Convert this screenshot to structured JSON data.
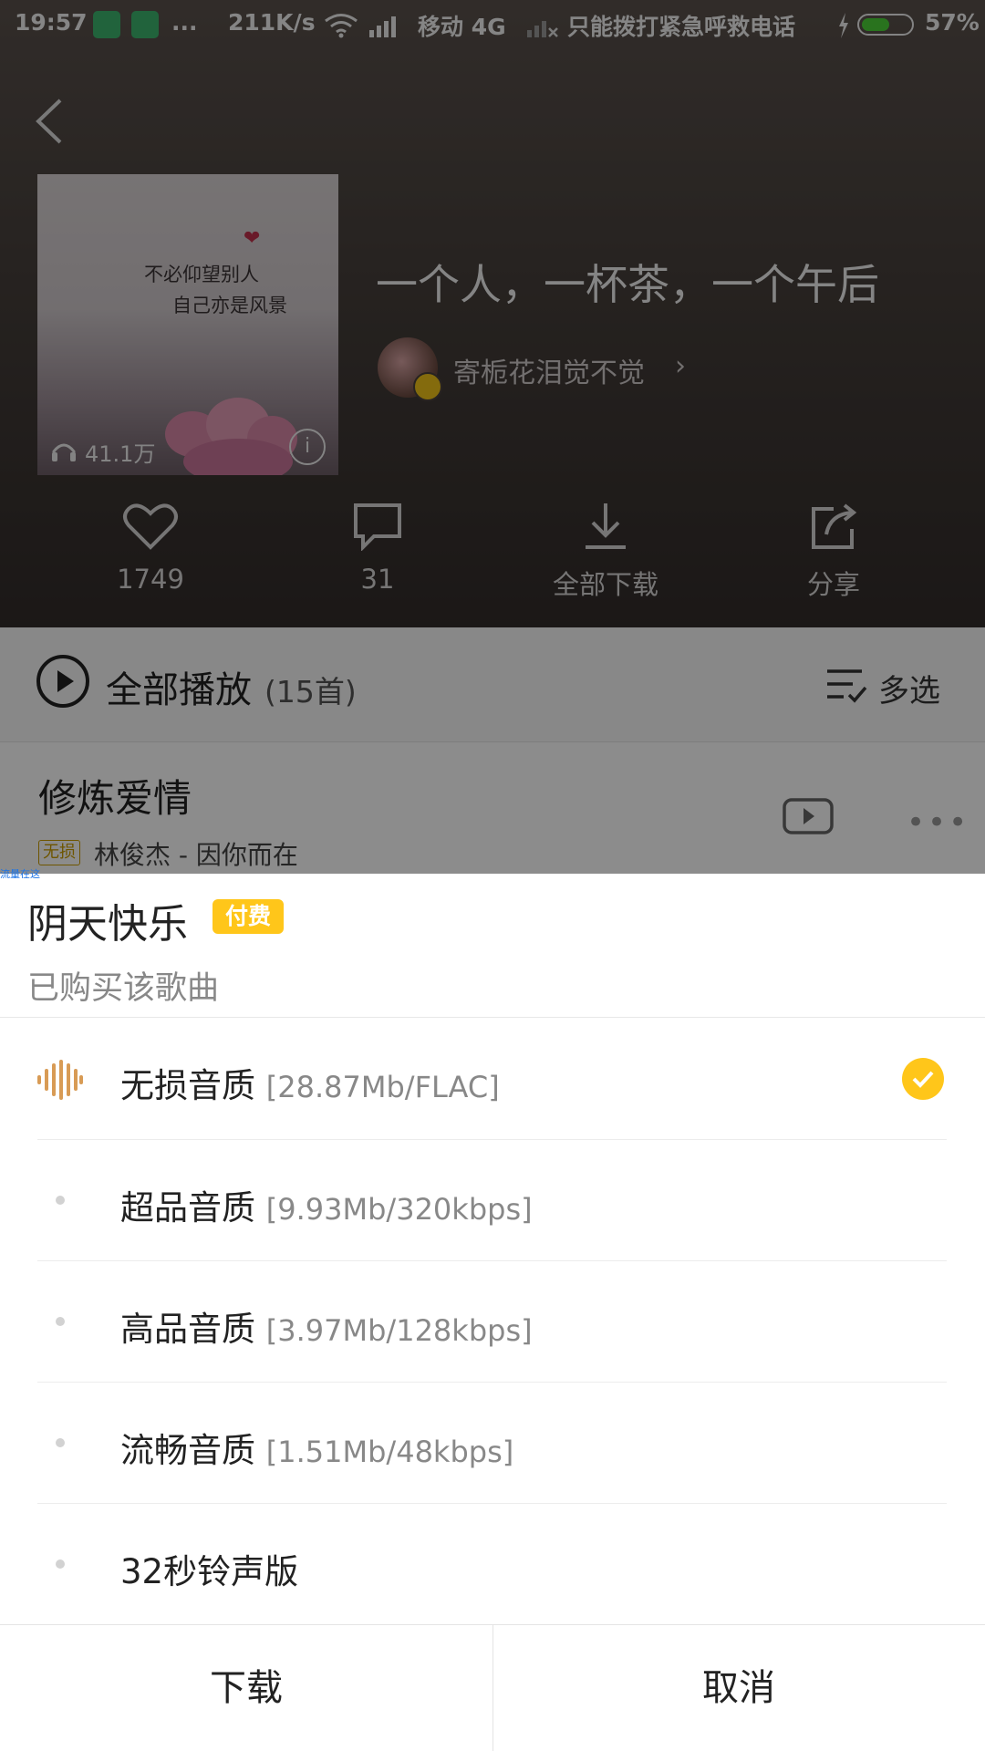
{
  "status_bar": {
    "time": "19:57",
    "overflow": "...",
    "net_speed": "211K/s",
    "carrier": "移动 4G",
    "emergency_text": "只能拨打紧急呼救电话",
    "battery": "57%"
  },
  "playlist": {
    "title": "一个人，一杯茶，一个午后",
    "creator": "寄栀花泪觉不觉",
    "cover_text_1": "不必仰望别人",
    "cover_text_2": "自己亦是风景",
    "play_count": "41.1万",
    "info_icon": "i"
  },
  "actions": [
    {
      "icon": "heart-icon",
      "label": "1749"
    },
    {
      "icon": "comment-icon",
      "label": "31"
    },
    {
      "icon": "download-icon",
      "label": "全部下载"
    },
    {
      "icon": "share-icon",
      "label": "分享"
    }
  ],
  "play_all": {
    "label": "全部播放",
    "count": "(15首)",
    "multiselect": "多选"
  },
  "song": {
    "title": "修炼爱情",
    "badge": "无损",
    "subtitle": "林俊杰 - 因你而在"
  },
  "watermark": "流量在这",
  "sheet": {
    "title": "阴天快乐",
    "paid_badge": "付费",
    "subtitle": "已购买该歌曲",
    "options": [
      {
        "name": "无损音质",
        "meta": "[28.87Mb/FLAC]",
        "selected": true
      },
      {
        "name": "超品音质",
        "meta": "[9.93Mb/320kbps]",
        "selected": false
      },
      {
        "name": "高品音质",
        "meta": "[3.97Mb/128kbps]",
        "selected": false
      },
      {
        "name": "流畅音质",
        "meta": "[1.51Mb/48kbps]",
        "selected": false
      },
      {
        "name": "32秒铃声版",
        "meta": "",
        "selected": false
      }
    ],
    "download_button": "下载",
    "cancel_button": "取消"
  },
  "colors": {
    "accent": "#ffc61a",
    "header_bg": "#463f3b"
  }
}
